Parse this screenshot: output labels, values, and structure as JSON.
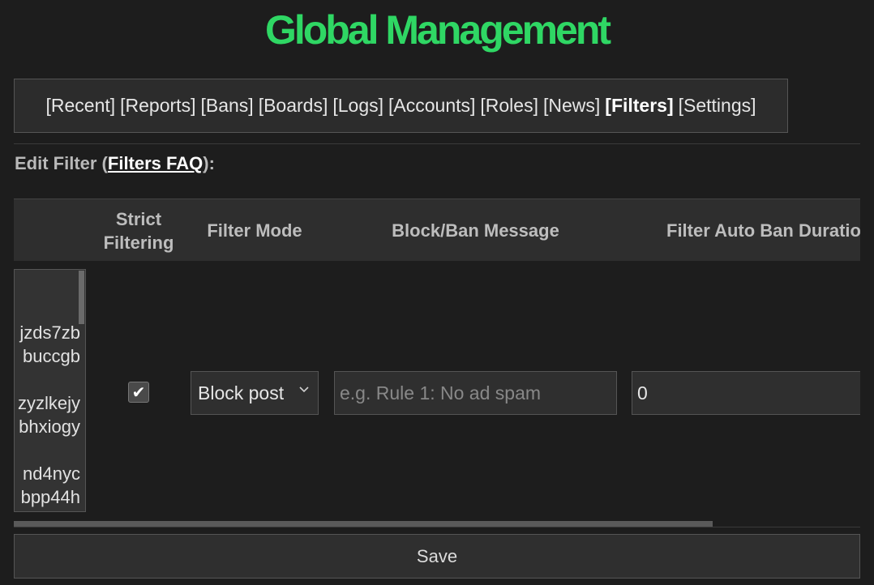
{
  "page": {
    "title": "Global Management"
  },
  "nav": {
    "items": [
      {
        "label": "[Recent]"
      },
      {
        "label": "[Reports]"
      },
      {
        "label": "[Bans]"
      },
      {
        "label": "[Boards]"
      },
      {
        "label": "[Logs]"
      },
      {
        "label": "[Accounts]"
      },
      {
        "label": "[Roles]"
      },
      {
        "label": "[News]"
      },
      {
        "label": "[Filters]",
        "active": true
      },
      {
        "label": "[Settings]"
      }
    ]
  },
  "edit_filter": {
    "prefix": "Edit Filter (",
    "faq_link": "Filters FAQ",
    "suffix": "):"
  },
  "table": {
    "headers": {
      "strict_line1": "Strict",
      "strict_line2": "Filtering",
      "filter_mode": "Filter Mode",
      "block_message": "Block/Ban Message",
      "auto_ban": "Filter Auto Ban Duratio"
    },
    "filters_textarea_lines": [
      "jzds7zb",
      "buccgb",
      "zyzlkejy",
      "bhxiogy",
      "nd4nyc",
      "bpp44h"
    ],
    "strict_checked": true,
    "strict_check_glyph": "✔",
    "filter_mode_value": "Block post",
    "block_message_placeholder": "e.g. Rule 1: No ad spam",
    "auto_ban_value": "0"
  },
  "save_label": "Save",
  "colors": {
    "title": "#2fd764",
    "background": "#1d1d1d",
    "panel": "#2c2c2c"
  }
}
